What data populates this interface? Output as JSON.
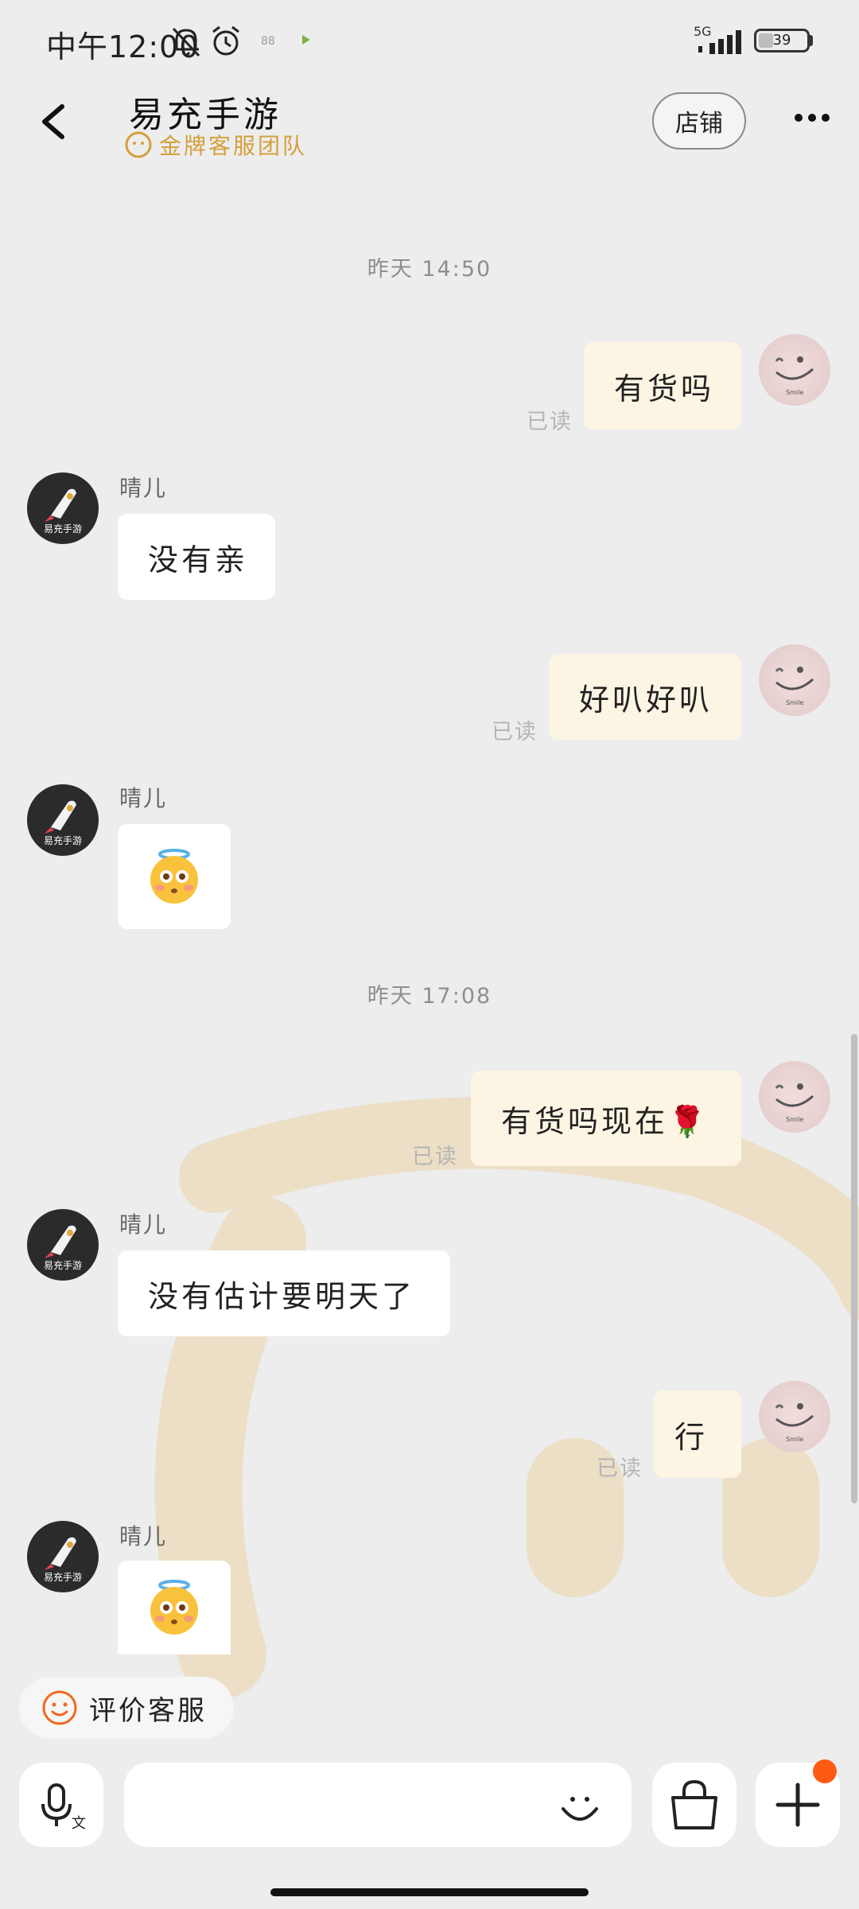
{
  "status_bar": {
    "time": "中午12:00",
    "network": "5G",
    "battery": "39",
    "small_dots": "88"
  },
  "header": {
    "title": "易充手游",
    "subtitle": "金牌客服团队",
    "store_button": "店铺"
  },
  "messages": {
    "ts1": "昨天 14:50",
    "ts2": "昨天 17:08",
    "shop_name": "晴儿",
    "read": "已读",
    "m1": "有货吗",
    "m2": "没有亲",
    "m3": "好叭好叭",
    "m5": "有货吗现在🌹",
    "m6": "没有估计要明天了",
    "m7": "行",
    "emoji": "🙈"
  },
  "shop_avatar_text": "易充手游",
  "self_avatar_text": "Smile",
  "rate_service": "评价客服",
  "input": {
    "placeholder": ""
  },
  "colors": {
    "self_bubble": "#fdf5e4",
    "shop_bubble": "#ffffff",
    "accent_gold": "#d4a03a",
    "notification": "#ff5a14"
  }
}
